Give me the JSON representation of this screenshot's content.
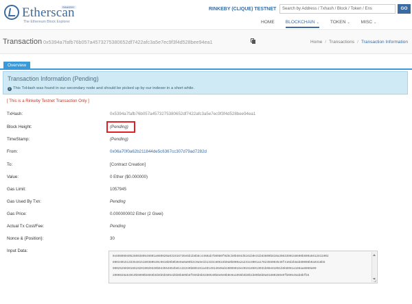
{
  "header": {
    "logo_text": "Etherscan",
    "logo_tagline": "The Ethereum Block Explorer",
    "logo_badge": "RINKEBY",
    "network_label": "RINKEBY (CLIQUE) TESTNET",
    "search_placeholder": "Search by Address / Txhash / Block / Token / Ens",
    "go_label": "GO",
    "nav": [
      {
        "label": "HOME"
      },
      {
        "label": "BLOCKCHAIN"
      },
      {
        "label": "TOKEN"
      },
      {
        "label": "MISC"
      }
    ]
  },
  "titlebar": {
    "title": "Transaction",
    "hash": "0x5394a7fafb76b057a4573275380652df7422afc3a5e7ec9f3f4d528bee94ea1",
    "breadcrumb": [
      "Home",
      "Transactions",
      "Transaction Information"
    ]
  },
  "tabs": {
    "overview": "Overview"
  },
  "info": {
    "title": "Transaction Information (Pending)",
    "text": "This TxHash was found in our secondary node and should be picked up by our indexer in a short while."
  },
  "testnet_note": "[ This is a Rinkeby Testnet Transaction Only ]",
  "fields": {
    "txhash_label": "TxHash:",
    "txhash_value": "0x5394a7fafb76b057a4573275380652df7422afc3a5e7ec9f3f4d528bee94ea1",
    "block_label": "Block Height:",
    "block_value": "(Pending)",
    "timestamp_label": "TimeStamp:",
    "timestamp_value": "(Pending)",
    "from_label": "From:",
    "from_value": "0x06a70f0a62b211844de5c6367cc307d79ad7282d",
    "to_label": "To:",
    "to_value": "[Contract Creation]",
    "value_label": "Value:",
    "value_value": "0 Ether ($0.000000)",
    "gaslimit_label": "Gas Limit:",
    "gaslimit_value": "1057945",
    "gasused_label": "Gas Used By Txn:",
    "gasused_value": "Pending",
    "gasprice_label": "Gas Price:",
    "gasprice_value": "0.000000002 Ether (2 Gwei)",
    "txcost_label": "Actual Tx Cost/Fee:",
    "txcost_value": "Pending",
    "nonce_label": "Nonce & {Position}:",
    "nonce_value": "30",
    "input_label": "Input Data:"
  },
  "input_data": {
    "lines": [
      "0x6080604052600380546001a060020a031916735e5b1b8b6c4460ab7b0080f0d5cb0b604d5161b0e31b83800b810a3083390158600b600a5612811002",
      "80034015133354815180380540c0816b0b0b0e0a0a00b3c0a5e1b1333c80516b0a0b000a2a231e3001a1782356003546f410d2b8ab80008b9a0418b5",
      "9002526030185192019020340b043554854b81132249b805151a4914914049ab10095916e2015185013031b08e61051b5b8951a188aa8060a00",
      "2000828a64010b5000b6655b5b5b5b5054d5b0b805b8f655b5b6280540b8e0e0b0e0a1055b5b0b1b00b8b0a01800280e0fb09546ab8bfb5"
    ]
  }
}
